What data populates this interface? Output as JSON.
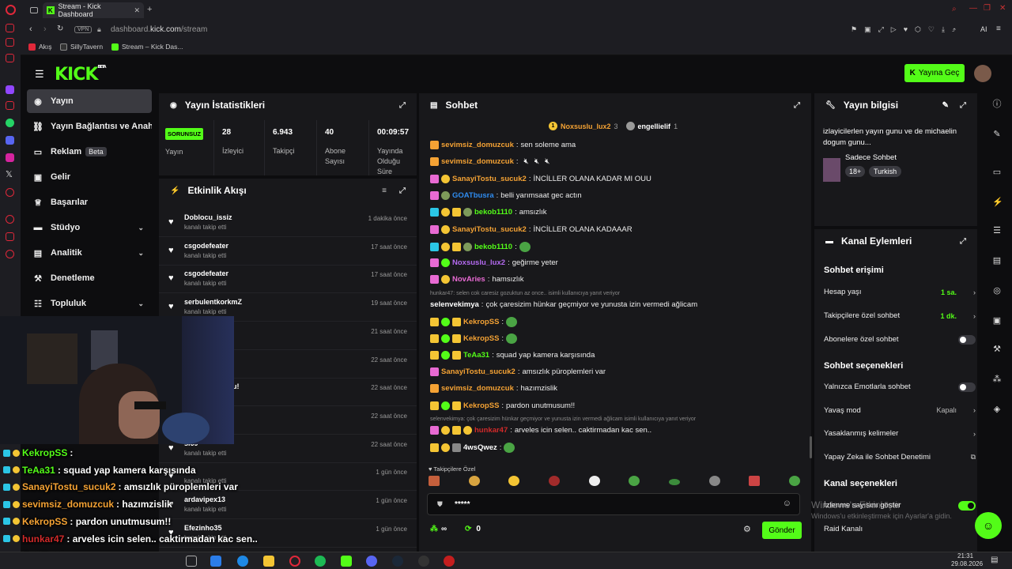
{
  "browser": {
    "tab_title": "Stream - Kick Dashboard",
    "url_prefix": "dashboard.",
    "url_domain": "kick.com",
    "url_path": "/stream",
    "vpn": "VPN",
    "bookmarks": [
      "Akış",
      "SillyTavern",
      "Stream – Kick Das..."
    ]
  },
  "header": {
    "logo": "KICK",
    "logo_sup": "BETA",
    "go_live": "Yayına Geç"
  },
  "nav": {
    "items": [
      {
        "label": "Yayın",
        "icon": "home-icon"
      },
      {
        "label": "Yayın Bağlantısı ve Anahtarı",
        "icon": "link-icon"
      },
      {
        "label": "Reklam",
        "icon": "ad-icon",
        "badge": "Beta"
      },
      {
        "label": "Gelir",
        "icon": "dollar-icon"
      },
      {
        "label": "Başarılar",
        "icon": "trophy-icon"
      },
      {
        "label": "Stüdyo",
        "icon": "studio-icon"
      },
      {
        "label": "Analitik",
        "icon": "chart-icon"
      },
      {
        "label": "Denetleme",
        "icon": "hammer-icon"
      },
      {
        "label": "Topluluk",
        "icon": "community-icon"
      }
    ]
  },
  "stats": {
    "title": "Yayın İstatistikleri",
    "status": "SORUNSUZ",
    "status_label": "Yayın",
    "items": [
      {
        "value": "28",
        "label": "İzleyici"
      },
      {
        "value": "6.943",
        "label": "Takipçi"
      },
      {
        "value": "40",
        "label": "Abone Sayısı"
      },
      {
        "value": "00:09:57",
        "label": "Yayında Olduğu Süre"
      }
    ]
  },
  "activity": {
    "title": "Etkinlik Akışı",
    "items": [
      {
        "name": "Doblocu_issiz",
        "sub": "kanalı takip etti",
        "time": "1 dakika önce"
      },
      {
        "name": "csgodefeater",
        "sub": "kanalı takip etti",
        "time": "17 saat önce"
      },
      {
        "name": "csgodefeater",
        "sub": "kanalı takip etti",
        "time": "17 saat önce"
      },
      {
        "name": "serbulentkorkmZ",
        "sub": "kanalı takip etti",
        "time": "19 saat önce"
      },
      {
        "name": "mmaab",
        "sub": "",
        "time": "21 saat önce"
      },
      {
        "name": "",
        "sub": "",
        "time": "22 saat önce"
      },
      {
        "name": "den abone oldu!",
        "sub": "dular",
        "time": "22 saat önce"
      },
      {
        "name": "",
        "sub": "",
        "time": "22 saat önce"
      },
      {
        "name": "si69",
        "sub": "kanalı takip etti",
        "time": "22 saat önce"
      },
      {
        "name": "",
        "sub": "kanalı takip etti",
        "time": "1 gün önce"
      },
      {
        "name": "ardavipex13",
        "sub": "kanalı takip etti",
        "time": "1 gün önce"
      },
      {
        "name": "Efezinho35",
        "sub": "kanalı takip etti",
        "time": "1 gün önce"
      }
    ]
  },
  "chat": {
    "title": "Sohbet",
    "pinned_user": "Noxsuslu_lux2",
    "pinned_count": "3",
    "pinned_user2": "engellielif",
    "pinned_count2": "1",
    "messages": [
      {
        "user": "sevimsiz_domuzcuk",
        "color": "#f4a234",
        "text": "sen soleme ama",
        "badges": [
          "#f4a234"
        ]
      },
      {
        "user": "sevimsiz_domuzcuk",
        "color": "#f4a234",
        "text": "",
        "badges": [
          "#f4a234"
        ],
        "mute": true
      },
      {
        "user": "SanayiTostu_sucuk2",
        "color": "#f4a234",
        "text": "İNCİLLER OLANA KADAR MI OUU",
        "badges": [
          "#e86ad3",
          "#f4c534"
        ]
      },
      {
        "user": "GOATbusra",
        "color": "#2f8cf0",
        "text": "belli yarımsaat gec actın",
        "badges": [
          "#e86ad3",
          "#7d9a5a"
        ]
      },
      {
        "user": "bekob1110",
        "color": "#53fc18",
        "text": "amsızlık",
        "badges": [
          "#2bc6e6",
          "#f4c534",
          "#f4c534",
          "#7d9a5a"
        ]
      },
      {
        "user": "SanayiTostu_sucuk2",
        "color": "#f4a234",
        "text": "İNCİLLER OLANA KADAAAR",
        "badges": [
          "#e86ad3",
          "#f4c534"
        ]
      },
      {
        "user": "bekob1110",
        "color": "#53fc18",
        "text": "",
        "badges": [
          "#2bc6e6",
          "#f4c534",
          "#f4c534",
          "#7d9a5a"
        ],
        "emote": true
      },
      {
        "user": "Noxsuslu_lux2",
        "color": "#b46af0",
        "text": "geğirme yeter",
        "badges": [
          "#e86ad3",
          "#53fc18"
        ]
      },
      {
        "user": "NovAries",
        "color": "#e86ad3",
        "text": "hamsızlık",
        "badges": [
          "#e86ad3",
          "#f4c534"
        ]
      },
      {
        "reply": "hunkar47: selen cok caresiz gozuktun az once.. isimli kullanıcıya yanıt veriyor",
        "user": "selenvekimya",
        "color": "#ffffff",
        "text": "çok çaresizim hünkar geçmiyor ve yunusta izin vermedi ağlicam",
        "badges": []
      },
      {
        "user": "KekropSS",
        "color": "#f4a234",
        "text": "",
        "badges": [
          "#f4c534",
          "#53fc18",
          "#f4c534"
        ],
        "emote": true
      },
      {
        "user": "KekropSS",
        "color": "#f4a234",
        "text": "",
        "badges": [
          "#f4c534",
          "#53fc18",
          "#f4c534"
        ],
        "emote": true
      },
      {
        "user": "TeAa31",
        "color": "#53fc18",
        "text": "squad yap kamera karşısında",
        "badges": [
          "#f4c534",
          "#53fc18",
          "#f4c534"
        ]
      },
      {
        "user": "SanayiTostu_sucuk2",
        "color": "#f4a234",
        "text": "amsızlık püroplemleri var",
        "badges": [
          "#e86ad3"
        ]
      },
      {
        "user": "sevimsiz_domuzcuk",
        "color": "#f4a234",
        "text": "hazımzislik",
        "badges": [
          "#f4a234"
        ]
      },
      {
        "user": "KekropSS",
        "color": "#f4a234",
        "text": "pardon unutmusum!!",
        "badges": [
          "#f4c534",
          "#53fc18",
          "#f4c534"
        ]
      },
      {
        "reply": "selenvekimya: çok çaresizim hünkar geçmiyor ve yunusta izin vermedi ağlicam isimli kullanıcıya yanıt veriyor",
        "user": "hunkar47",
        "color": "#d22a2a",
        "text": "arveles icin selen.. caktirmadan kac sen..",
        "badges": [
          "#e86ad3",
          "#f4c534",
          "#f4c534",
          "#f4c534"
        ]
      },
      {
        "user": "4wsQwez",
        "color": "#ffffff",
        "text": "",
        "badges": [
          "#f4c534",
          "#f4c534",
          "#888"
        ],
        "emote": true
      }
    ],
    "followers_only": "Takipçilere Özel",
    "input_value": "*****",
    "points": "∞",
    "count": "0",
    "send": "Gönder"
  },
  "stream_info": {
    "title": "Yayın bilgisi",
    "text": "izlayicilerlen yayın gunu ve de michaelin dogum gunu...",
    "category": "Sadece Sohbet",
    "tags": [
      "18+",
      "Turkish"
    ]
  },
  "channel_actions": {
    "title": "Kanal Eylemleri",
    "chat_access": "Sohbet erişimi",
    "rows1": [
      {
        "label": "Hesap yaşı",
        "value": "1 sa.",
        "type": "arrow"
      },
      {
        "label": "Takipçilere özel sohbet",
        "value": "1 dk.",
        "type": "arrow"
      },
      {
        "label": "Abonelere özel sohbet",
        "type": "toggle"
      }
    ],
    "chat_options": "Sohbet seçenekleri",
    "rows2": [
      {
        "label": "Yalnızca Emotlarla sohbet",
        "type": "toggle"
      },
      {
        "label": "Yavaş mod",
        "value": "Kapalı",
        "type": "arrow"
      },
      {
        "label": "Yasaklanmış kelimeler",
        "type": "arrow"
      },
      {
        "label": "Yapay Zeka ile Sohbet Denetimi",
        "type": "ext"
      }
    ],
    "channel_options": "Kanal seçenekleri",
    "rows3": [
      {
        "label": "İzlenme sayısını göster",
        "type": "toggle-on"
      },
      {
        "label": "Raid Kanalı"
      }
    ]
  },
  "windows": {
    "activate_title": "Windows'u Etkinleştir",
    "activate_sub": "Windows'u etkinleştirmek için Ayarlar'a gidin.",
    "time": "21:31",
    "date": "29.08.2026"
  },
  "overlay": [
    {
      "user": "KekropSS",
      "color": "#53fc18",
      "text": ":"
    },
    {
      "user": "TeAa31",
      "color": "#53fc18",
      "text": ": squad yap kamera karşısında"
    },
    {
      "user": "SanayiTostu_sucuk2",
      "color": "#f4a234",
      "text": ": amsızlık püroplemleri var"
    },
    {
      "user": "sevimsiz_domuzcuk",
      "color": "#f4a234",
      "text": ": hazımzislik"
    },
    {
      "user": "KekropSS",
      "color": "#f4a234",
      "text": ": pardon unutmusum!!"
    },
    {
      "user": "hunkar47",
      "color": "#d22a2a",
      "text": ": arveles icin selen.. caktirmadan kac sen.."
    },
    {
      "user": "4wsQwez",
      "color": "#ffffff",
      "text": ":"
    }
  ]
}
